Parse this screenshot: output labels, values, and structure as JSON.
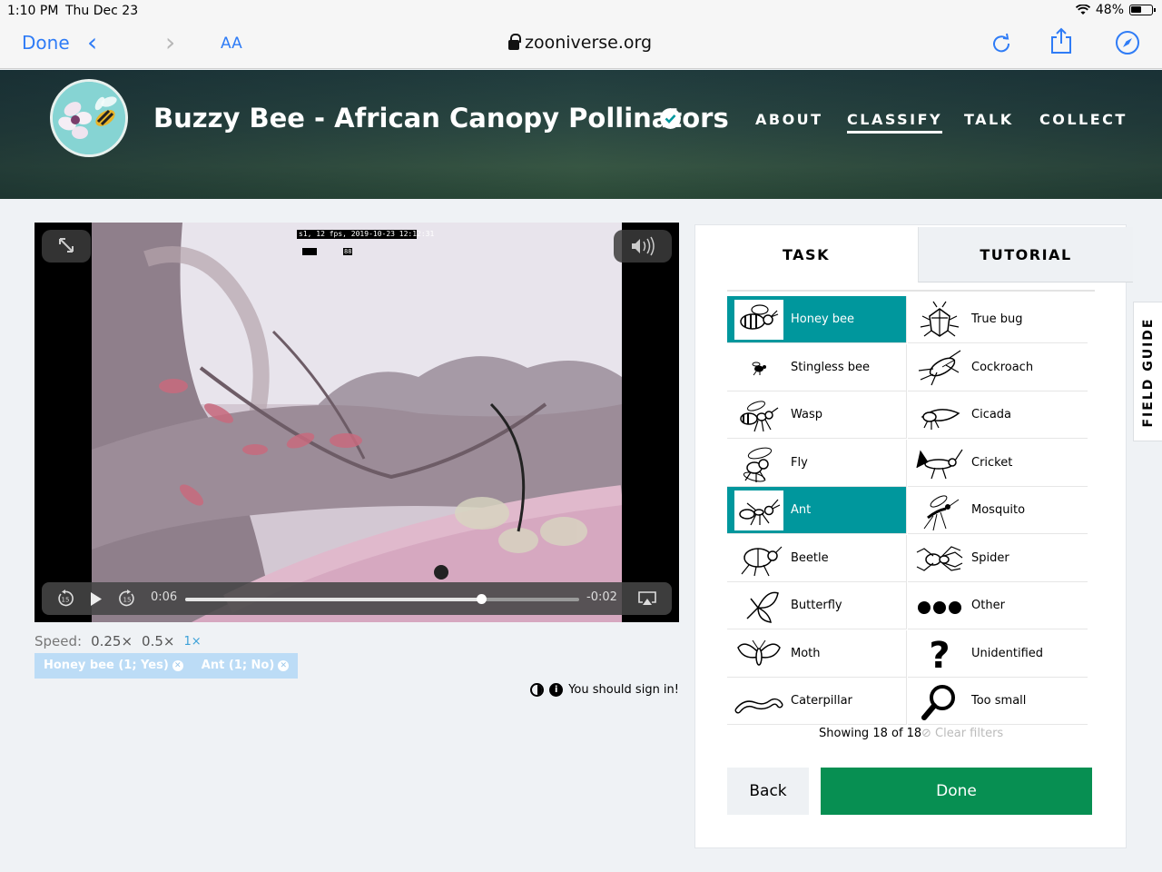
{
  "status_bar": {
    "time": "1:10 PM",
    "date": "Thu Dec 23",
    "battery": "48%"
  },
  "browser": {
    "done_label": "Done",
    "text_size_label": "AA",
    "url": "zooniverse.org"
  },
  "project": {
    "title": "Buzzy Bee - African Canopy Pollinators",
    "nav": [
      "ABOUT",
      "CLASSIFY",
      "TALK",
      "COLLECT"
    ],
    "active_nav": "CLASSIFY"
  },
  "video": {
    "overlay_text": "s1, 12 fps, 2019-10-23 12:12:31",
    "overlay_small": "88",
    "elapsed": "0:06",
    "remaining": "-0:02",
    "progress": 0.75,
    "skip_seconds": "15"
  },
  "speed": {
    "label": "Speed:",
    "options": [
      "0.25×",
      "0.5×",
      "1×"
    ],
    "selected": "1×"
  },
  "annotations": [
    "Honey bee (1; Yes)",
    "Ant (1; No)"
  ],
  "sign_in_text": "You should sign in!",
  "panel": {
    "tabs": [
      "TASK",
      "TUTORIAL"
    ],
    "choices": [
      {
        "label": "Honey bee",
        "icon": "honey-bee-icon",
        "selected": true
      },
      {
        "label": "True bug",
        "icon": "true-bug-icon",
        "selected": false
      },
      {
        "label": "Stingless bee",
        "icon": "stingless-bee-icon",
        "selected": false
      },
      {
        "label": "Cockroach",
        "icon": "cockroach-icon",
        "selected": false
      },
      {
        "label": "Wasp",
        "icon": "wasp-icon",
        "selected": false
      },
      {
        "label": "Cicada",
        "icon": "cicada-icon",
        "selected": false
      },
      {
        "label": "Fly",
        "icon": "fly-icon",
        "selected": false
      },
      {
        "label": "Cricket",
        "icon": "cricket-icon",
        "selected": false
      },
      {
        "label": "Ant",
        "icon": "ant-icon",
        "selected": true
      },
      {
        "label": "Mosquito",
        "icon": "mosquito-icon",
        "selected": false
      },
      {
        "label": "Beetle",
        "icon": "beetle-icon",
        "selected": false
      },
      {
        "label": "Spider",
        "icon": "spider-icon",
        "selected": false
      },
      {
        "label": "Butterfly",
        "icon": "butterfly-icon",
        "selected": false
      },
      {
        "label": "Other",
        "icon": "three-dots-icon",
        "selected": false
      },
      {
        "label": "Moth",
        "icon": "moth-icon",
        "selected": false
      },
      {
        "label": "Unidentified",
        "icon": "question-mark-icon",
        "selected": false
      },
      {
        "label": "Caterpillar",
        "icon": "caterpillar-icon",
        "selected": false
      },
      {
        "label": "Too small",
        "icon": "magnifier-icon",
        "selected": false
      }
    ],
    "showing": "Showing 18 of 18",
    "clear_filters": "Clear filters",
    "back_label": "Back",
    "done_label": "Done"
  },
  "field_guide_label": "FIELD GUIDE",
  "colors": {
    "selected_choice": "#00979d",
    "done_button": "#078f52",
    "link_blue": "#2f7cf6"
  }
}
